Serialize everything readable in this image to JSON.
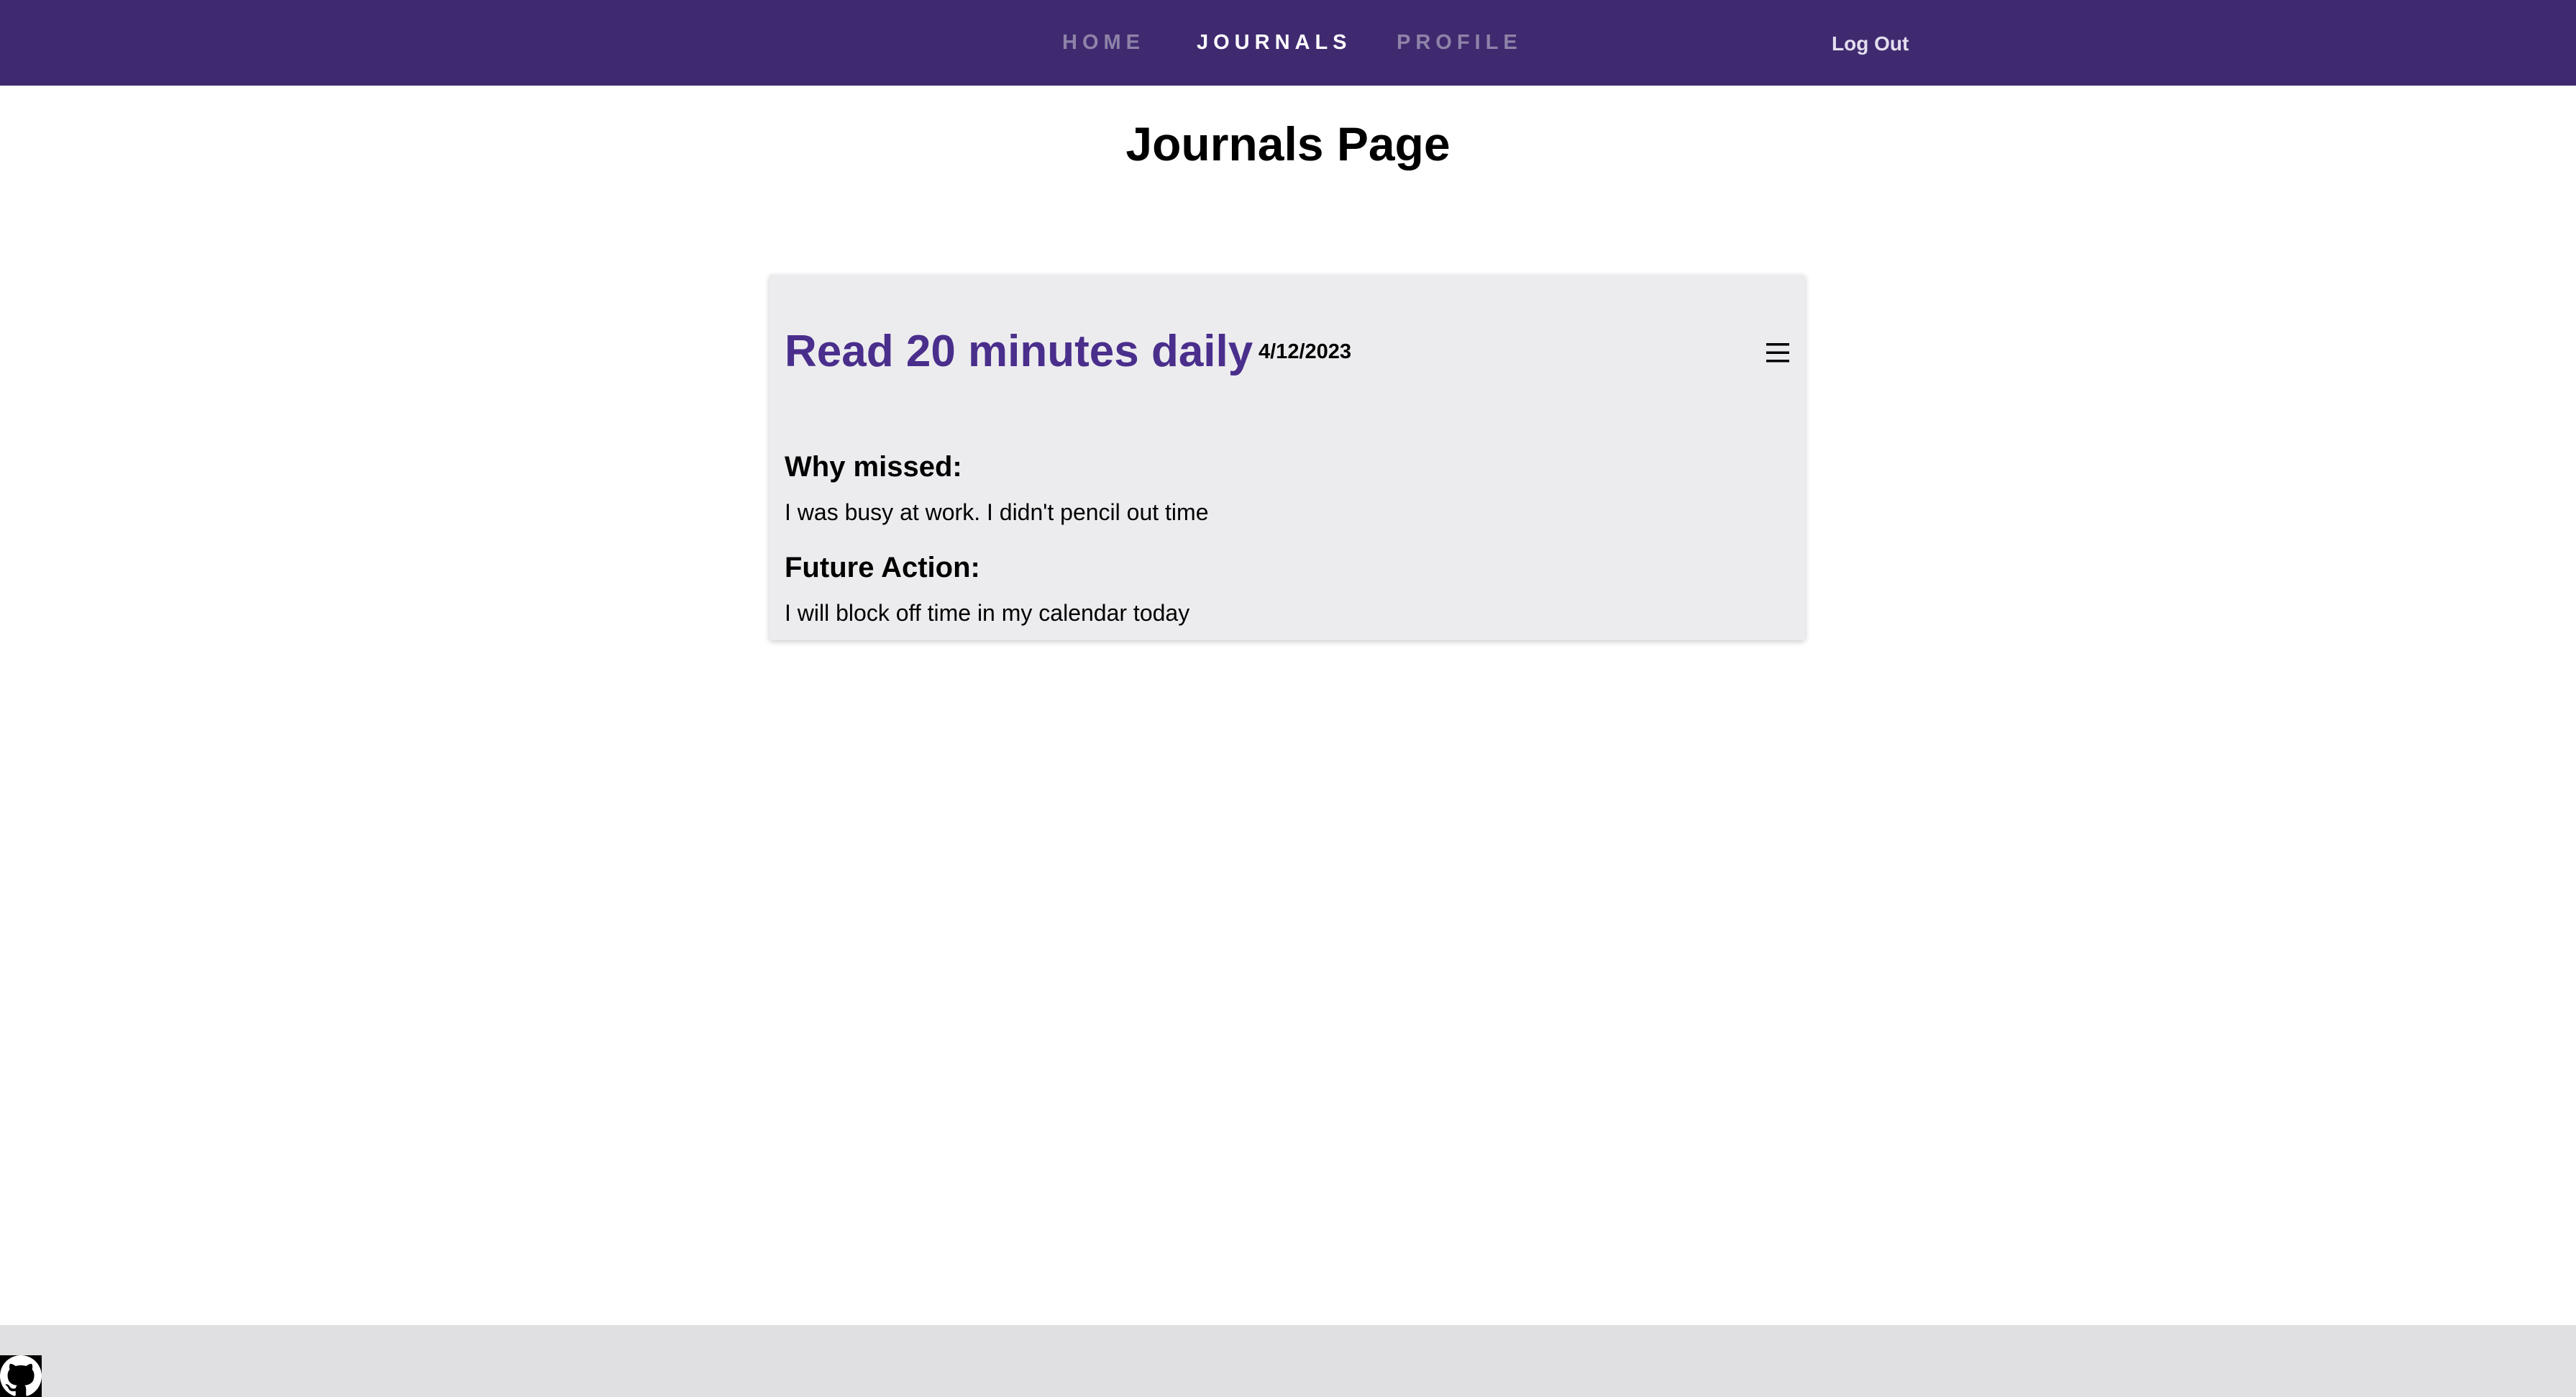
{
  "nav": {
    "links": [
      {
        "label": "HOME"
      },
      {
        "label": "JOURNALS",
        "active": true
      },
      {
        "label": "PROFILE"
      }
    ],
    "logout_label": "Log Out"
  },
  "page": {
    "title": "Journals Page"
  },
  "journal_entry": {
    "title": "Read 20 minutes daily",
    "date": "4/12/2023",
    "menu_icon": "hamburger-menu-icon",
    "why_missed_heading": "Why missed:",
    "why_missed_text": "I was busy at work. I didn't pencil out time",
    "future_action_heading": "Future Action:",
    "future_action_text": "I will block off time in my calendar today"
  },
  "footer": {
    "icon": "github-icon"
  },
  "colors": {
    "navbar_bg": "#3f2a70",
    "nav_inactive": "#8e83a8",
    "nav_active": "#ffffff",
    "card_bg": "#ececee",
    "card_title": "#4a2e8c",
    "footer_bg": "#e0e0e2"
  }
}
